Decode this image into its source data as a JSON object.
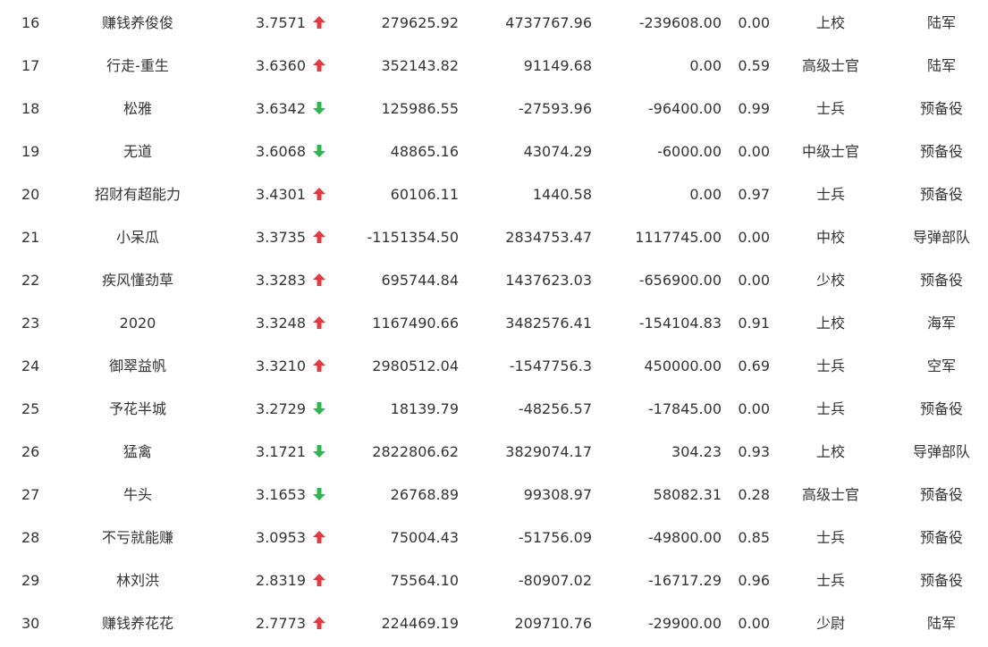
{
  "colors": {
    "text": "#333333",
    "up": "#e8383d",
    "down": "#2eb84b"
  },
  "rows": [
    {
      "rank": "16",
      "name": "赚钱养俊俊",
      "score": "3.7571",
      "trend": "up",
      "trend_icon": "arrow-up-icon",
      "v1": "279625.92",
      "v2": "4737767.96",
      "v3": "-239608.00",
      "ratio": "0.00",
      "rank_title": "上校",
      "branch": "陆军"
    },
    {
      "rank": "17",
      "name": "行走-重生",
      "score": "3.6360",
      "trend": "up",
      "trend_icon": "arrow-up-icon",
      "v1": "352143.82",
      "v2": "91149.68",
      "v3": "0.00",
      "ratio": "0.59",
      "rank_title": "高级士官",
      "branch": "陆军"
    },
    {
      "rank": "18",
      "name": "松雅",
      "score": "3.6342",
      "trend": "down",
      "trend_icon": "arrow-down-icon",
      "v1": "125986.55",
      "v2": "-27593.96",
      "v3": "-96400.00",
      "ratio": "0.99",
      "rank_title": "士兵",
      "branch": "预备役"
    },
    {
      "rank": "19",
      "name": "无道",
      "score": "3.6068",
      "trend": "down",
      "trend_icon": "arrow-down-icon",
      "v1": "48865.16",
      "v2": "43074.29",
      "v3": "-6000.00",
      "ratio": "0.00",
      "rank_title": "中级士官",
      "branch": "预备役"
    },
    {
      "rank": "20",
      "name": "招财有超能力",
      "score": "3.4301",
      "trend": "up",
      "trend_icon": "arrow-up-icon",
      "v1": "60106.11",
      "v2": "1440.58",
      "v3": "0.00",
      "ratio": "0.97",
      "rank_title": "士兵",
      "branch": "预备役"
    },
    {
      "rank": "21",
      "name": "小呆瓜",
      "score": "3.3735",
      "trend": "up",
      "trend_icon": "arrow-up-icon",
      "v1": "-1151354.50",
      "v2": "2834753.47",
      "v3": "1117745.00",
      "ratio": "0.00",
      "rank_title": "中校",
      "branch": "导弹部队"
    },
    {
      "rank": "22",
      "name": "疾风懂劲草",
      "score": "3.3283",
      "trend": "up",
      "trend_icon": "arrow-up-icon",
      "v1": "695744.84",
      "v2": "1437623.03",
      "v3": "-656900.00",
      "ratio": "0.00",
      "rank_title": "少校",
      "branch": "预备役"
    },
    {
      "rank": "23",
      "name": "2020",
      "score": "3.3248",
      "trend": "up",
      "trend_icon": "arrow-up-icon",
      "v1": "1167490.66",
      "v2": "3482576.41",
      "v3": "-154104.83",
      "ratio": "0.91",
      "rank_title": "上校",
      "branch": "海军"
    },
    {
      "rank": "24",
      "name": "御翠益帆",
      "score": "3.3210",
      "trend": "up",
      "trend_icon": "arrow-up-icon",
      "v1": "2980512.04",
      "v2": "-1547756.3",
      "v3": "450000.00",
      "ratio": "0.69",
      "rank_title": "士兵",
      "branch": "空军"
    },
    {
      "rank": "25",
      "name": "予花半城",
      "score": "3.2729",
      "trend": "down",
      "trend_icon": "arrow-down-icon",
      "v1": "18139.79",
      "v2": "-48256.57",
      "v3": "-17845.00",
      "ratio": "0.00",
      "rank_title": "士兵",
      "branch": "预备役"
    },
    {
      "rank": "26",
      "name": "猛禽",
      "score": "3.1721",
      "trend": "down",
      "trend_icon": "arrow-down-icon",
      "v1": "2822806.62",
      "v2": "3829074.17",
      "v3": "304.23",
      "ratio": "0.93",
      "rank_title": "上校",
      "branch": "导弹部队"
    },
    {
      "rank": "27",
      "name": "牛头",
      "score": "3.1653",
      "trend": "down",
      "trend_icon": "arrow-down-icon",
      "v1": "26768.89",
      "v2": "99308.97",
      "v3": "58082.31",
      "ratio": "0.28",
      "rank_title": "高级士官",
      "branch": "预备役"
    },
    {
      "rank": "28",
      "name": "不亏就能赚",
      "score": "3.0953",
      "trend": "up",
      "trend_icon": "arrow-up-icon",
      "v1": "75004.43",
      "v2": "-51756.09",
      "v3": "-49800.00",
      "ratio": "0.85",
      "rank_title": "士兵",
      "branch": "预备役"
    },
    {
      "rank": "29",
      "name": "林刘洪",
      "score": "2.8319",
      "trend": "up",
      "trend_icon": "arrow-up-icon",
      "v1": "75564.10",
      "v2": "-80907.02",
      "v3": "-16717.29",
      "ratio": "0.96",
      "rank_title": "士兵",
      "branch": "预备役"
    },
    {
      "rank": "30",
      "name": "赚钱养花花",
      "score": "2.7773",
      "trend": "up",
      "trend_icon": "arrow-up-icon",
      "v1": "224469.19",
      "v2": "209710.76",
      "v3": "-29900.00",
      "ratio": "0.00",
      "rank_title": "少尉",
      "branch": "陆军"
    }
  ]
}
